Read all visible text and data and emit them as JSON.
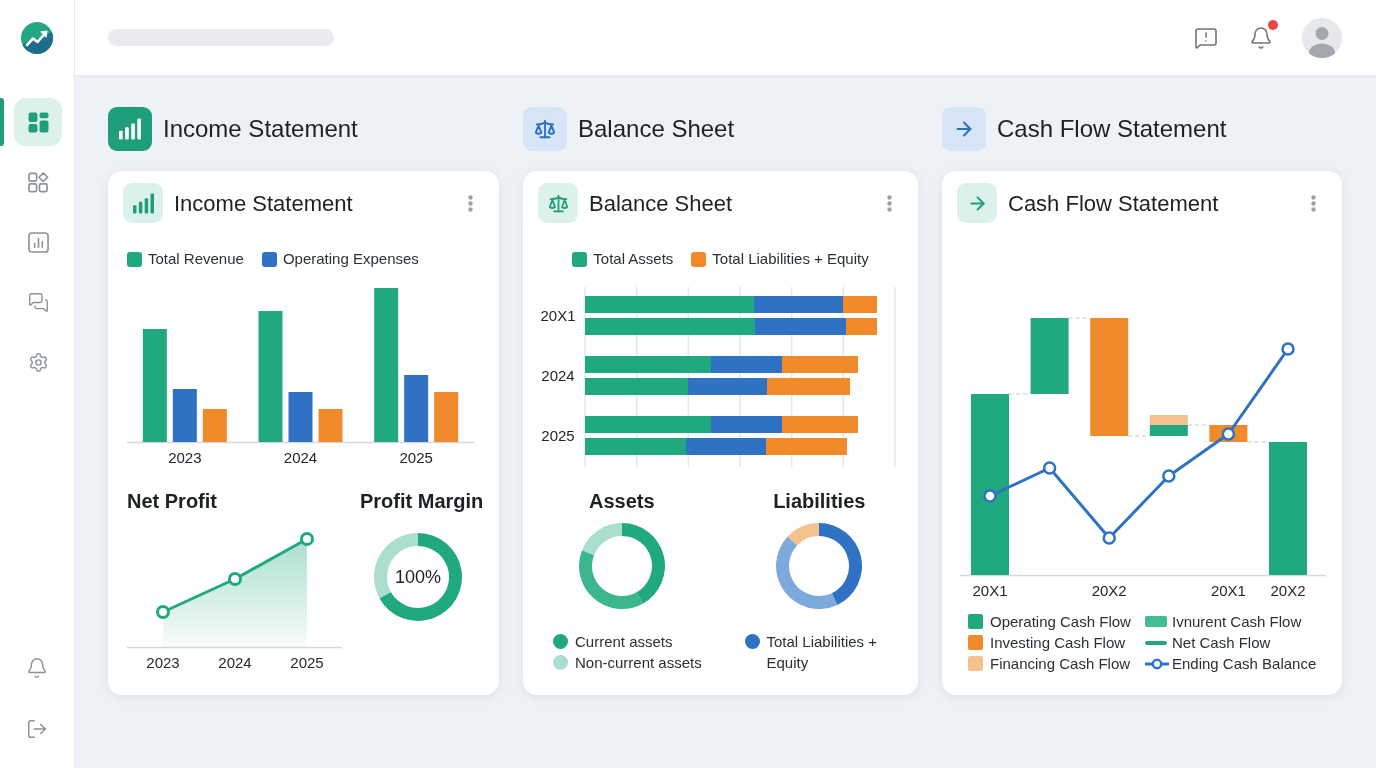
{
  "sidebar": {
    "nav": [
      {
        "selected": true
      },
      {
        "selected": false
      },
      {
        "selected": false
      },
      {
        "selected": false
      },
      {
        "selected": false
      }
    ]
  },
  "topbar": {
    "notifications": {
      "unread": true
    }
  },
  "sections": [
    {
      "kind": "income",
      "title": "Income Statement",
      "selected": true
    },
    {
      "kind": "balance",
      "title": "Balance Sheet",
      "selected": false
    },
    {
      "kind": "cash",
      "title": "Cash Flow Statement",
      "selected": false
    }
  ],
  "cards": [
    {
      "kind": "income",
      "title": "Income Statement",
      "revenue_chart": {
        "legend": [
          {
            "label": "Total Revenue",
            "color": "#20a97f"
          },
          {
            "label": "Operating Expenses",
            "color": "#2f72c4"
          }
        ],
        "axis_labels": [
          "2023",
          "2024",
          "2025"
        ]
      },
      "net_profit": {
        "title": "Net Profit",
        "axis_labels": [
          "2023",
          "2024",
          "2025"
        ]
      },
      "profit_margin": {
        "chart_data": {
          "type": "donut",
          "title": "Profit Margin",
          "annotations": [
            "100%"
          ],
          "values": [
            67,
            33
          ],
          "colors": [
            "#20a97f",
            "#a9dfcb"
          ]
        }
      }
    },
    {
      "kind": "balance",
      "title": "Balance Sheet",
      "position_chart": {
        "legend": [
          {
            "label": "Total Assets",
            "color": "#20a97f"
          },
          {
            "label": "Total Liabilities + Equity",
            "color": "#f08a2a"
          }
        ],
        "axis_labels": [
          "20X1",
          "2024",
          "2025"
        ]
      },
      "assets": {
        "chart_data": {
          "type": "donut",
          "title": "Assets",
          "values": [
            42,
            39,
            19
          ],
          "colors": [
            "#20a97f",
            "#3cb68c",
            "#a9dfcb"
          ]
        },
        "legend": [
          {
            "label": "Current assets",
            "color": "#20a97f"
          },
          {
            "label": "Non-current assets",
            "color": "#a9dfcb"
          }
        ]
      },
      "liabilities": {
        "chart_data": {
          "type": "donut",
          "title": "Liabilities",
          "values": [
            43,
            44,
            13
          ],
          "colors": [
            "#2f72c4",
            "#7ea9dc",
            "#f4c28e"
          ]
        },
        "legend": [
          {
            "label": "Total Liabilities + Equity",
            "color": "#2f72c4"
          }
        ]
      }
    },
    {
      "kind": "cash",
      "title": "Cash Flow Statement",
      "flow_chart": {
        "axis_labels": [
          "20X1",
          "20X2",
          "20X1",
          "20X2"
        ],
        "legend": [
          {
            "kind": "square",
            "label": "Operating Cash Flow",
            "color": "#20a97f"
          },
          {
            "kind": "bar",
            "label": "Ivnurent Cash Flow",
            "color": "#45bb92"
          },
          {
            "kind": "square",
            "label": "Investing Cash Flow",
            "color": "#f08a2a"
          },
          {
            "kind": "line",
            "label": "Net Cash Flow",
            "color": "#20a97f"
          },
          {
            "kind": "square",
            "label": "Financing Cash Flow",
            "color": "#f4c28e"
          },
          {
            "kind": "marker-line",
            "label": "Ending Cash Balance",
            "color": "#2f72c4"
          }
        ]
      }
    }
  ]
}
